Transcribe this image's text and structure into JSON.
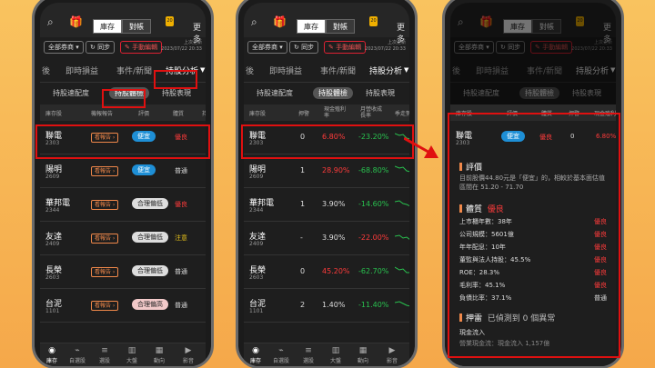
{
  "common": {
    "topbar": {
      "seg_left": "庫存",
      "seg_right": "對帳",
      "badge": "20",
      "more": "更多"
    },
    "tools": {
      "account": "全部券商 ▾",
      "sync": "同步",
      "edit": "手動編輯",
      "updated_label": "上次更新",
      "updated_time": "2023/07/22 20:33"
    },
    "tabs": [
      "即時損益",
      "事件/新聞",
      "持股分析"
    ],
    "subtabs": [
      "持股速配度",
      "持股體檢",
      "持股表現"
    ],
    "bottom_nav": [
      {
        "label": "庫存",
        "icon": "inventory-icon"
      },
      {
        "label": "自選股",
        "icon": "chart-icon"
      },
      {
        "label": "選股",
        "icon": "filter-icon"
      },
      {
        "label": "大盤",
        "icon": "market-icon"
      },
      {
        "label": "動向",
        "icon": "trend-icon"
      },
      {
        "label": "影音",
        "icon": "video-icon"
      }
    ]
  },
  "phone1": {
    "headers": [
      "庫存股",
      "機報報告",
      "評價",
      "體質",
      "持"
    ],
    "rows": [
      {
        "name": "聯電",
        "code": "2303",
        "report": "看報告 ›",
        "valuation": "便宜",
        "health": "優良",
        "health_color": "red"
      },
      {
        "name": "陽明",
        "code": "2609",
        "report": "看報告 ›",
        "valuation": "便宜",
        "health": "普通",
        "health_color": "wht"
      },
      {
        "name": "華邦電",
        "code": "2344",
        "report": "看報告 ›",
        "valuation": "合理偏低",
        "health": "優良",
        "health_color": "red"
      },
      {
        "name": "友達",
        "code": "2409",
        "report": "看報告 ›",
        "valuation": "合理偏低",
        "health": "注意",
        "health_color": "yel"
      },
      {
        "name": "長榮",
        "code": "2603",
        "report": "看報告 ›",
        "valuation": "合理偏低",
        "health": "普通",
        "health_color": "wht"
      },
      {
        "name": "台泥",
        "code": "1101",
        "report": "看報告 ›",
        "valuation": "合理偏高",
        "health": "普通",
        "health_color": "wht"
      }
    ]
  },
  "phone2": {
    "headers": [
      "庫存股",
      "押警",
      "現金殖利率",
      "月營收成長率",
      "季走勢"
    ],
    "rows": [
      {
        "name": "聯電",
        "code": "2303",
        "alerts": "0",
        "yield": "6.80%",
        "growth": "-23.20%"
      },
      {
        "name": "陽明",
        "code": "2609",
        "alerts": "1",
        "yield": "28.90%",
        "growth": "-68.80%"
      },
      {
        "name": "華邦電",
        "code": "2344",
        "alerts": "1",
        "yield": "3.90%",
        "growth": "-14.60%"
      },
      {
        "name": "友達",
        "code": "2409",
        "alerts": "-",
        "yield": "3.90%",
        "growth": "-22.00%"
      },
      {
        "name": "長榮",
        "code": "2603",
        "alerts": "0",
        "yield": "45.20%",
        "growth": "-62.70%"
      },
      {
        "name": "台泥",
        "code": "1101",
        "alerts": "2",
        "yield": "1.40%",
        "growth": "-11.40%"
      }
    ]
  },
  "phone3": {
    "headers": [
      "庫存股",
      "評價",
      "體質",
      "押警",
      "現金殖利率"
    ],
    "stock": {
      "name": "聯電",
      "code": "2303",
      "valuation": "便宜",
      "health": "優良",
      "alerts": "0",
      "yield": "6.80%"
    },
    "valuation_title": "評價",
    "valuation_note": "目前股價44.80元是「便宜」的，相較於基本面估值區間在 51.20 - 71.70",
    "health_title": "體質",
    "health_value": "優良",
    "metrics": [
      {
        "k": "上市櫃年數：38年",
        "v": "優良"
      },
      {
        "k": "公司規模：5601億",
        "v": "優良"
      },
      {
        "k": "年年配息：10年",
        "v": "優良"
      },
      {
        "k": "董監與法人持股：45.5%",
        "v": "優良"
      },
      {
        "k": "ROE：28.3%",
        "v": "優良"
      },
      {
        "k": "毛利率：45.1%",
        "v": "優良"
      },
      {
        "k": "負債比率：37.1%",
        "v": "普通"
      }
    ],
    "alert_title": "押雷",
    "alert_value": "已偵測到 0 個異常",
    "cash_label": "現金流入",
    "cash_sub": "營業現金流：現金流入 1,157億"
  }
}
